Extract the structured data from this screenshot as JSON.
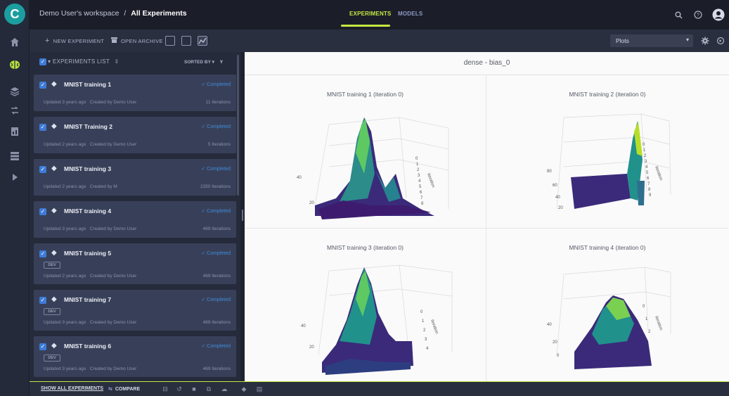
{
  "workspace": {
    "name": "Demo User's workspace",
    "separator": "/",
    "page": "All Experiments"
  },
  "nav": {
    "tabs": [
      {
        "label": "EXPERIMENTS",
        "active": true
      },
      {
        "label": "MODELS",
        "active": false
      }
    ]
  },
  "toolbar": {
    "new_experiment": "NEW EXPERIMENT",
    "open_archive": "OPEN ARCHIVE",
    "plots_select": "Plots"
  },
  "list": {
    "header": "EXPERIMENTS LIST",
    "sorted_by": "SORTED BY",
    "items": [
      {
        "name": "MNIST training 1",
        "status": "Completed",
        "updated": "Updated 3 years ago",
        "created_by": "Created by Demo User",
        "iterations": "11 Iterations",
        "tag": ""
      },
      {
        "name": "MNIST Training 2",
        "status": "Completed",
        "updated": "Updated 2 years ago",
        "created_by": "Created by Demo User",
        "iterations": "5 Iterations",
        "tag": ""
      },
      {
        "name": "MNIST training 3",
        "status": "Completed",
        "updated": "Updated 2 years ago",
        "created_by": "Created by M",
        "iterations": "2350 Iterations",
        "tag": ""
      },
      {
        "name": "MNIST training 4",
        "status": "Completed",
        "updated": "Updated 3 years ago",
        "created_by": "Created by Demo User",
        "iterations": "469 Iterations",
        "tag": ""
      },
      {
        "name": "MNIST training 5",
        "status": "Completed",
        "updated": "Updated 2 years ago",
        "created_by": "Created by Demo User",
        "iterations": "469 Iterations",
        "tag": "DEV"
      },
      {
        "name": "MNIST training 7",
        "status": "Completed",
        "updated": "Updated 3 years ago",
        "created_by": "Created by Demo User",
        "iterations": "469 Iterations",
        "tag": "DEV"
      },
      {
        "name": "MNIST training 6",
        "status": "Completed",
        "updated": "Updated 3 years ago",
        "created_by": "Created by Demo User",
        "iterations": "469 Iterations",
        "tag": "DEV"
      }
    ]
  },
  "plots": {
    "group_title": "dense - bias_0",
    "cells": [
      {
        "title": "MNIST training 1 (iteration 0)",
        "axis": "iteration",
        "ticks": [
          "0",
          "1",
          "2",
          "3",
          "4",
          "5",
          "6",
          "7",
          "8"
        ],
        "side_ticks": [
          "40",
          "20"
        ]
      },
      {
        "title": "MNIST training 2 (iteration 0)",
        "axis": "iteration",
        "ticks": [
          "0",
          "1",
          "2",
          "3",
          "4",
          "5",
          "6",
          "7",
          "8",
          "9"
        ],
        "side_ticks": [
          "80",
          "60",
          "40",
          "20"
        ]
      },
      {
        "title": "MNIST training 3 (iteration 0)",
        "axis": "iteration",
        "ticks": [
          "0",
          "1",
          "2",
          "3",
          "4"
        ],
        "side_ticks": [
          "40",
          "20"
        ]
      },
      {
        "title": "MNIST training 4 (iteration 0)",
        "axis": "iteration",
        "ticks": [
          "0",
          "1",
          "2"
        ],
        "side_ticks": [
          "40",
          "20",
          "0"
        ]
      }
    ]
  },
  "bottom": {
    "show_all": "SHOW ALL EXPERIMENTS",
    "compare": "COMPARE"
  },
  "colors": {
    "accent": "#c6e842",
    "status": "#3f8bd9",
    "card": "#384059",
    "surface_low": "#440154",
    "surface_mid": "#21918c",
    "surface_high": "#fde725"
  }
}
